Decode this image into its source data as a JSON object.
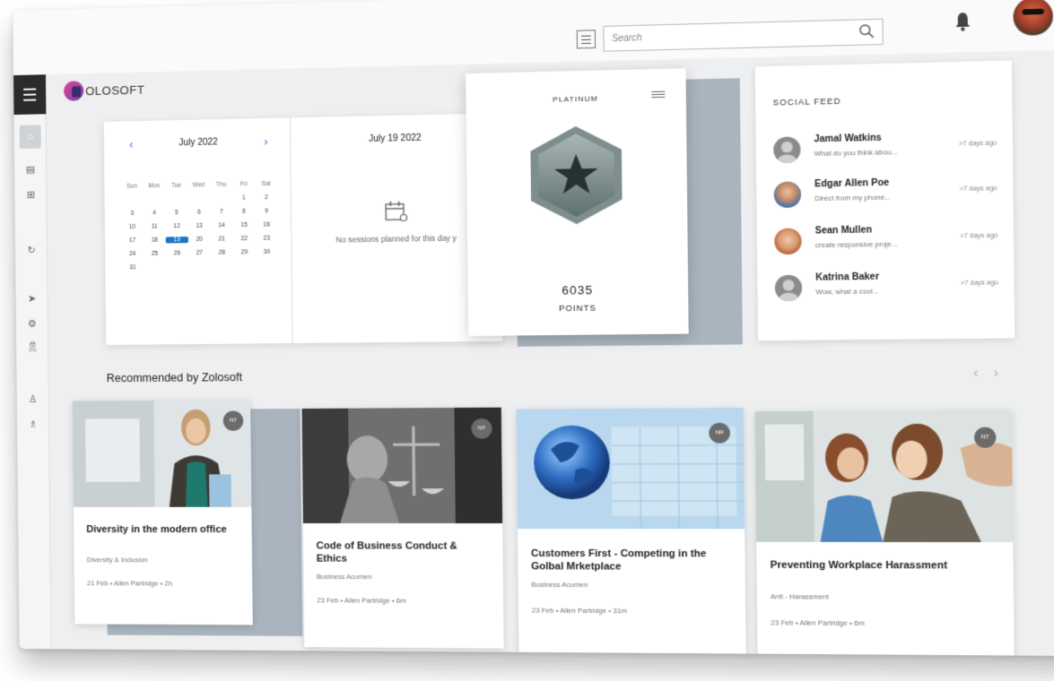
{
  "header": {
    "search_placeholder": "Search"
  },
  "brand": {
    "name": "OLOSOFT",
    "accent": "#d63d8e"
  },
  "calendar": {
    "month_label": "July 2022",
    "prev": "‹",
    "next": "›",
    "weekdays": [
      "Sun",
      "Mon",
      "Tue",
      "Wed",
      "Thu",
      "Fri",
      "Sat"
    ],
    "days": [
      "",
      "",
      "",
      "",
      "",
      "1",
      "2",
      "3",
      "4",
      "5",
      "6",
      "7",
      "8",
      "9",
      "10",
      "11",
      "12",
      "13",
      "14",
      "15",
      "16",
      "17",
      "18",
      "19",
      "20",
      "21",
      "22",
      "23",
      "24",
      "25",
      "26",
      "27",
      "28",
      "29",
      "30",
      "31"
    ],
    "selected_day": "19",
    "selected_date": "July 19 2022",
    "empty_message": "No sessions planned for this day y",
    "selected_color": "#1f73c8"
  },
  "platinum": {
    "title": "PLATINUM",
    "points": "6035",
    "points_label": "POINTS"
  },
  "social": {
    "title": "SOCIAL FEED",
    "items": [
      {
        "name": "Jamal Watkins",
        "text": "What do you think abou...",
        "time": ">7 days ago"
      },
      {
        "name": "Edgar Allen Poe",
        "text": "Direct from my phone...",
        "time": ">7 days ago"
      },
      {
        "name": "Sean Mullen",
        "text": "create responsive proje...",
        "time": ">7 days ago"
      },
      {
        "name": "Katrina Baker",
        "text": "Wow, what a cool...",
        "time": ">7 days ago"
      }
    ]
  },
  "recommended": {
    "title": "Recommended by Zolosoft",
    "arrows": "‹ ›",
    "courses": [
      {
        "title": "Diversity in the modern office",
        "category": "Diversity & Inclusion",
        "meta": "21 Feb • Allen Partridge • 2h",
        "badge": "NT"
      },
      {
        "title": "Code of Business Conduct & Ethics",
        "category": "Business Acumen",
        "meta": "23 Feb • Allen Partridge • 6m",
        "badge": "NT"
      },
      {
        "title": "Customers First - Competing in the Golbal Mrketplace",
        "category": "Business Acumen",
        "meta": "23 Feb • Allen Partridge • 31m",
        "badge": "NR"
      },
      {
        "title": "Preventing Workplace Harassment",
        "category": "Anti - Harassment",
        "meta": "23 Feb • Allen Partridge • 6m",
        "badge": "NT"
      }
    ]
  }
}
